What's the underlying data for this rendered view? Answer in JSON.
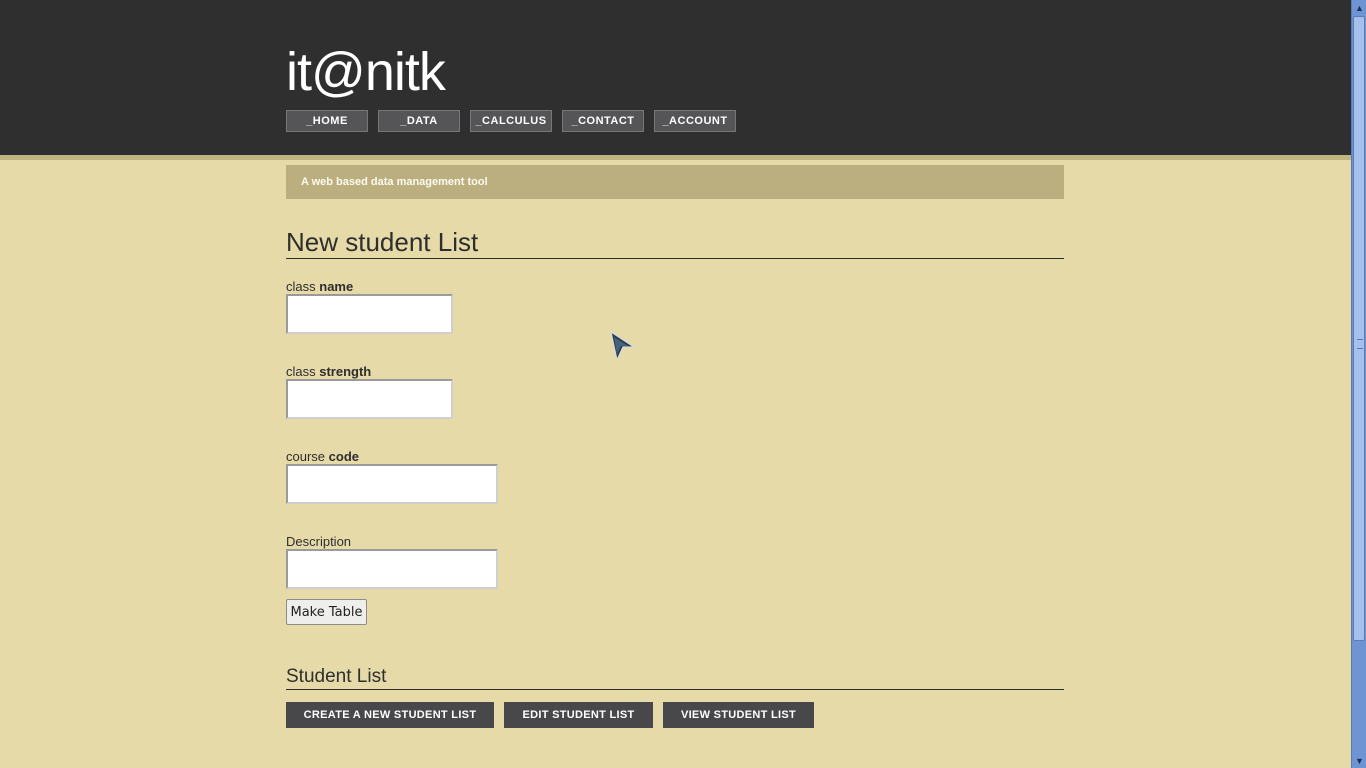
{
  "brand": "it@nitk",
  "nav": [
    {
      "label": "_HOME"
    },
    {
      "label": "_DATA"
    },
    {
      "label": "_CALCULUS"
    },
    {
      "label": "_CONTACT"
    },
    {
      "label": "_ACCOUNT"
    }
  ],
  "tagline": "A web based data management tool",
  "form": {
    "title": "New student List",
    "fields": [
      {
        "prefix": "class",
        "bold": "name",
        "value": ""
      },
      {
        "prefix": "class",
        "bold": "strength",
        "value": ""
      },
      {
        "prefix": "course",
        "bold": "code",
        "value": ""
      },
      {
        "prefix": "Description",
        "bold": "",
        "value": ""
      }
    ],
    "submit_label": "Make Table"
  },
  "student_list": {
    "title": "Student List",
    "buttons": [
      {
        "label": "CREATE A NEW STUDENT LIST"
      },
      {
        "label": "EDIT STUDENT LIST"
      },
      {
        "label": "VIEW STUDENT LIST"
      }
    ]
  },
  "icons": {
    "scroll_up": "arrow-up-icon",
    "scroll_down": "arrow-down-icon",
    "cursor": "mouse-cursor-icon"
  },
  "colors": {
    "header_bg": "#2f2f2f",
    "page_bg": "#e7daa9",
    "tagline_bg": "#bbae7f",
    "button_bg": "#48484a"
  }
}
